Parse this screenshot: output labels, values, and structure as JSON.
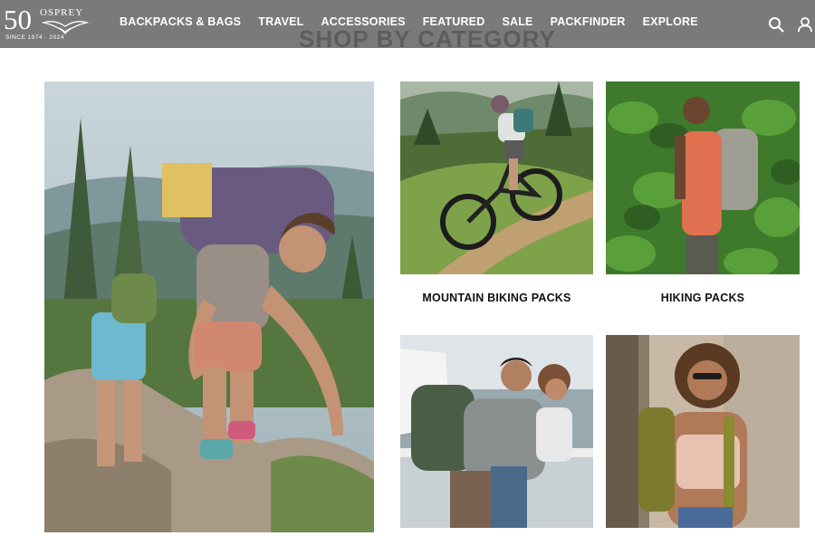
{
  "header": {
    "logo": {
      "number": "50",
      "brand": "OSPREY",
      "since": "SINCE 1974 · 2024"
    },
    "nav": [
      "BACKPACKS & BAGS",
      "TRAVEL",
      "ACCESSORIES",
      "FEATURED",
      "SALE",
      "PACKFINDER",
      "EXPLORE"
    ],
    "icons": {
      "search": "search-icon",
      "account": "user-icon"
    },
    "background_title": "SHOP BY CATEGORY",
    "colors": {
      "bar": "#7a7a7a",
      "text": "#ffffff"
    }
  },
  "tiles": [
    {
      "image": "hikers-scrambling-rocks",
      "caption": ""
    },
    {
      "image": "mountain-biker-trail",
      "caption": "MOUNTAIN BIKING PACKS"
    },
    {
      "image": "hiker-green-foliage",
      "caption": "HIKING PACKS"
    },
    {
      "image": "couple-ferry-travel",
      "caption": ""
    },
    {
      "image": "smiling-woman-daypack",
      "caption": ""
    }
  ]
}
